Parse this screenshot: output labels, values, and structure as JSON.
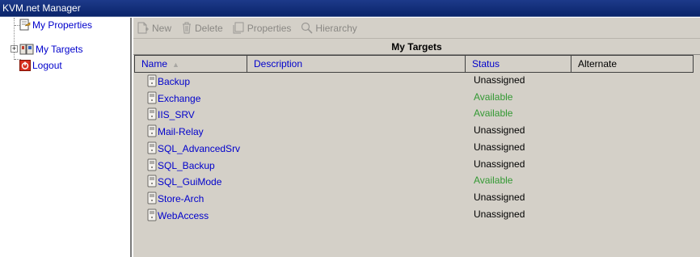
{
  "app": {
    "title": "KVM.net Manager"
  },
  "sidebar": {
    "items": [
      {
        "label": "My Properties",
        "icon": "properties-icon"
      },
      {
        "label": "My Targets",
        "icon": "targets-icon",
        "expander": "+"
      },
      {
        "label": "Logout",
        "icon": "logout-icon"
      }
    ]
  },
  "toolbar": {
    "new_label": "New",
    "delete_label": "Delete",
    "properties_label": "Properties",
    "hierarchy_label": "Hierarchy"
  },
  "panel": {
    "title": "My Targets"
  },
  "table": {
    "columns": [
      "Name",
      "Description",
      "Status",
      "Alternate"
    ],
    "sort_indicator": "▲",
    "rows": [
      {
        "name": "Backup",
        "status": "Unassigned"
      },
      {
        "name": "Exchange",
        "status": "Available"
      },
      {
        "name": "IIS_SRV",
        "status": "Available"
      },
      {
        "name": "Mail-Relay",
        "status": "Unassigned"
      },
      {
        "name": "SQL_AdvancedSrv",
        "status": "Unassigned"
      },
      {
        "name": "SQL_Backup",
        "status": "Unassigned"
      },
      {
        "name": "SQL_GuiMode",
        "status": "Available"
      },
      {
        "name": "Store-Arch",
        "status": "Unassigned"
      },
      {
        "name": "WebAccess",
        "status": "Unassigned"
      }
    ]
  },
  "colors": {
    "titlebar": "#0a246a",
    "link": "#0000cc",
    "available": "#339933",
    "unassigned": "#000000",
    "panel_bg": "#d4d0c8"
  }
}
